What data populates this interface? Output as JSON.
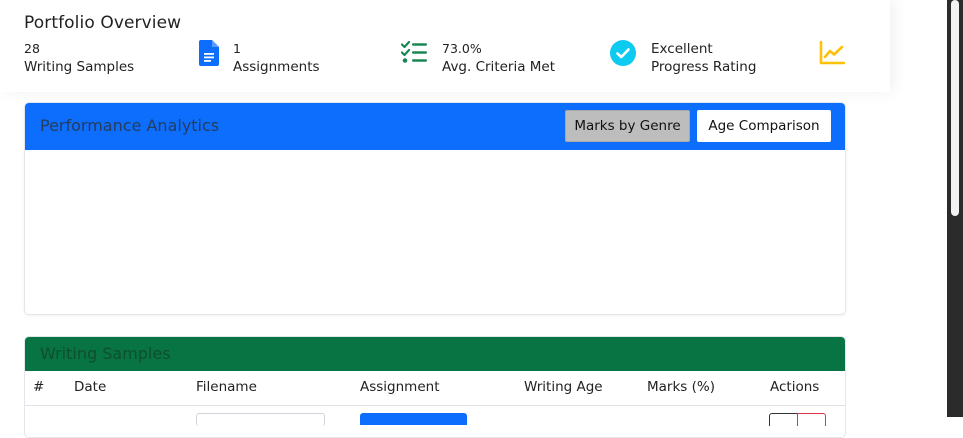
{
  "overview": {
    "title": "Portfolio Overview",
    "stats": [
      {
        "value": "28",
        "label": "Writing Samples",
        "icon": "none"
      },
      {
        "value": "1",
        "label": "Assignments",
        "icon": "document-icon",
        "color": "#0d6efd"
      },
      {
        "value": "73.0%",
        "label": "Avg. Criteria Met",
        "icon": "checklist-icon",
        "color": "#198754"
      },
      {
        "value": "Excellent",
        "label": "Progress Rating",
        "icon": "check-circle-icon",
        "color": "#0dcaf0"
      }
    ],
    "trend_icon_color": "#ffc107"
  },
  "performance": {
    "title": "Performance Analytics",
    "header_color": "#0d6efd",
    "tabs": [
      {
        "label": "Marks by Genre",
        "active": true
      },
      {
        "label": "Age Comparison",
        "active": false
      }
    ]
  },
  "writing_samples": {
    "title": "Writing Samples",
    "header_color": "#087443",
    "columns": [
      "#",
      "Date",
      "Filename",
      "Assignment",
      "Writing Age",
      "Marks (%)",
      "Actions"
    ]
  }
}
